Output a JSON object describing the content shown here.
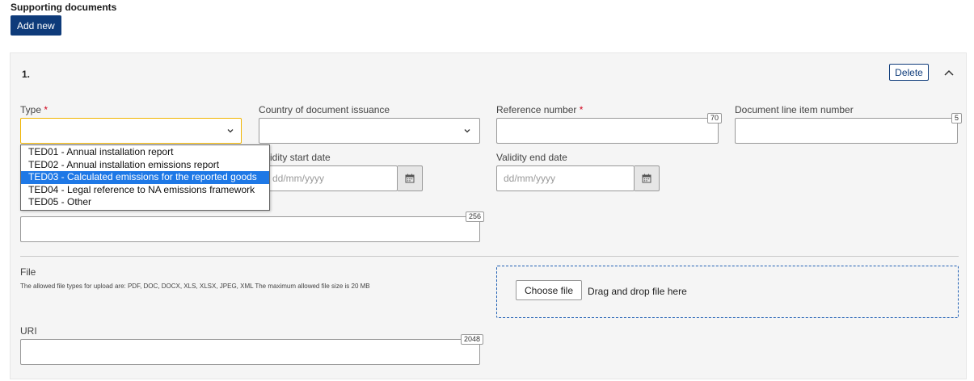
{
  "section": {
    "title": "Supporting documents",
    "add_label": "Add new"
  },
  "item": {
    "number": "1.",
    "delete_label": "Delete",
    "fields": {
      "type": {
        "label": "Type",
        "required": "*",
        "value": ""
      },
      "country": {
        "label": "Country of document issuance",
        "value": ""
      },
      "reference": {
        "label": "Reference number",
        "required": "*",
        "counter": "70",
        "value": ""
      },
      "line_item": {
        "label": "Document line item number",
        "counter": "5",
        "value": ""
      },
      "validity_start": {
        "label": "Validity start date",
        "visible_label": "idity start date",
        "placeholder": "dd/mm/yyyy"
      },
      "validity_end": {
        "label": "Validity end date",
        "placeholder": "dd/mm/yyyy"
      },
      "description": {
        "counter": "256",
        "value": ""
      },
      "file": {
        "label": "File",
        "hint": "The allowed file types for upload are: PDF, DOC, DOCX, XLS, XLSX, JPEG, XML The maximum allowed file size is 20 MB",
        "choose_label": "Choose file",
        "drag_text": "Drag and drop file here"
      },
      "uri": {
        "label": "URI",
        "counter": "2048",
        "value": ""
      }
    }
  },
  "type_dropdown": {
    "options": [
      "TED01 - Annual installation report",
      "TED02 - Annual installation emissions report",
      "TED03 - Calculated emissions for the reported goods",
      "TED04 - Legal reference to NA emissions framework",
      "TED05 - Other"
    ],
    "highlighted": "TED03 - Calculated emissions for the reported goods"
  },
  "icons": {
    "collapse": "chevron-up-icon",
    "select": "chevron-down-icon",
    "calendar": "calendar-icon"
  },
  "colors": {
    "primary": "#0e3b7a",
    "focus": "#f0b400",
    "required": "#d0021b",
    "highlight": "#1e78e6",
    "dropzone_border": "#1f5fb4"
  }
}
